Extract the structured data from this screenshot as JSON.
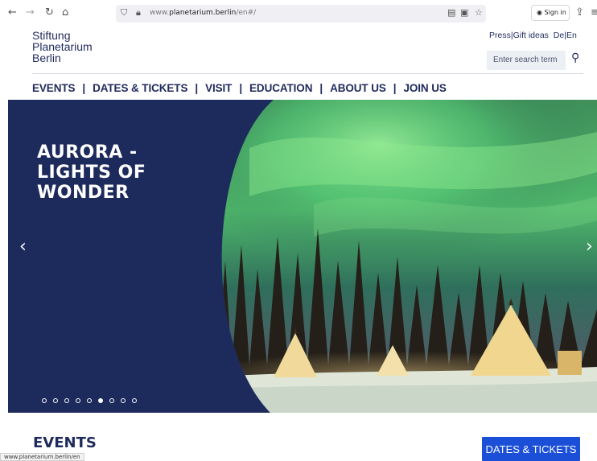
{
  "browser": {
    "url_prefix": "www.",
    "url_host": "planetarium.berlin",
    "url_path": "/en#/",
    "sign_in": "Sign in",
    "status_url": "www.planetarium.berlin/en"
  },
  "site": {
    "logo_line1": "Stiftung",
    "logo_line2": "Planetarium",
    "logo_line3": "Berlin",
    "top_links": {
      "press": "Press",
      "gift_ideas": "Gift ideas",
      "lang_de": "De",
      "lang_en": "En",
      "divider": "|"
    },
    "search_placeholder": "Enter search term"
  },
  "nav": {
    "items": [
      {
        "label": "EVENTS"
      },
      {
        "label": "DATES & TICKETS"
      },
      {
        "label": "VISIT"
      },
      {
        "label": "EDUCATION"
      },
      {
        "label": "ABOUT US"
      },
      {
        "label": "JOIN US"
      }
    ],
    "separator": "|"
  },
  "hero": {
    "title_line1": "AURORA -",
    "title_line2": "LIGHTS OF",
    "title_line3": "WONDER",
    "slide_count": 9,
    "active_slide": 6,
    "colors": {
      "panel": "#1d2a5c",
      "aurora": "#5fd37a",
      "snow": "#dfe6d8"
    }
  },
  "events": {
    "heading": "EVENTS",
    "cta_label": "DATES & TICKETS",
    "cta_color": "#1b4fd8"
  }
}
